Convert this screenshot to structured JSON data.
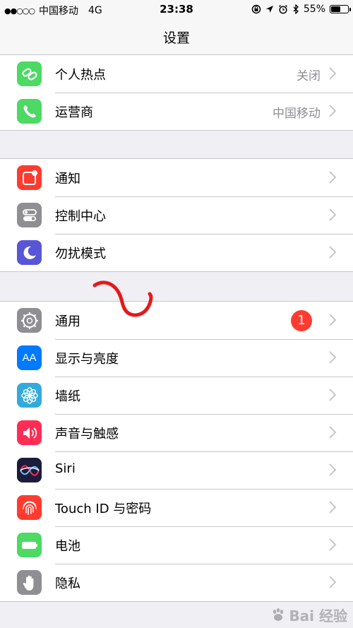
{
  "status_bar": {
    "signal": "●●○○○",
    "carrier": "中国移动",
    "network": "4G",
    "time": "23:38",
    "battery_percent": "55%",
    "battery_level": 0.55
  },
  "nav": {
    "title": "设置"
  },
  "groups": [
    [
      {
        "label": "个人热点",
        "value": "关闭",
        "icon": "hotspot-icon",
        "color": "#4cd964"
      },
      {
        "label": "运营商",
        "value": "中国移动",
        "icon": "phone-icon",
        "color": "#4cd964"
      }
    ],
    [
      {
        "label": "通知",
        "icon": "notifications-icon",
        "color": "#ff3b30"
      },
      {
        "label": "控制中心",
        "icon": "control-center-icon",
        "color": "#8e8e93"
      },
      {
        "label": "勿扰模式",
        "icon": "moon-icon",
        "color": "#5856d6"
      }
    ],
    [
      {
        "label": "通用",
        "badge": "1",
        "icon": "gear-icon",
        "color": "#8e8e93"
      },
      {
        "label": "显示与亮度",
        "icon_text": "AA",
        "icon": "display-icon",
        "color": "#007aff"
      },
      {
        "label": "墙纸",
        "icon": "wallpaper-icon",
        "color": "#34aadc"
      },
      {
        "label": "声音与触感",
        "icon": "speaker-icon",
        "color": "#ff2d55"
      },
      {
        "label": "Siri",
        "icon": "siri-icon",
        "color": "#1c1c3c"
      },
      {
        "label": "Touch ID 与密码",
        "icon": "fingerprint-icon",
        "color": "#ff3b30"
      },
      {
        "label": "电池",
        "icon": "battery-icon",
        "color": "#4cd964"
      },
      {
        "label": "隐私",
        "icon": "hand-icon",
        "color": "#8e8e93"
      }
    ]
  ],
  "watermark": {
    "text": "Bai 经验"
  }
}
